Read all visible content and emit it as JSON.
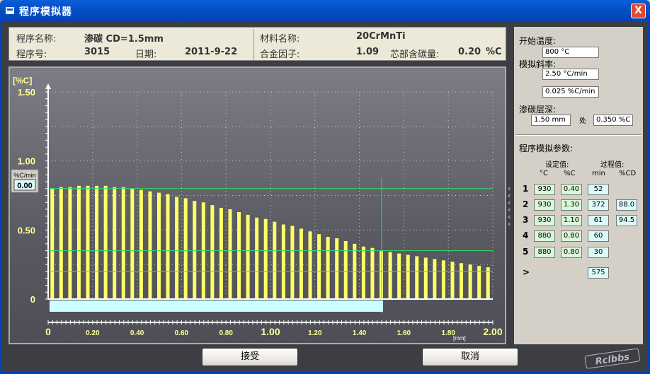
{
  "window": {
    "title": "程序模拟器",
    "close_glyph": "X"
  },
  "info": {
    "program_name_label": "程序名称:",
    "program_name": "渗碳 CD=1.5mm",
    "program_no_label": "程序号:",
    "program_no": "3015",
    "date_label": "日期:",
    "date": "2011-9-22",
    "material_label": "材料名称:",
    "material": "20CrMnTi",
    "alloy_label": "合金因子:",
    "alloy": "1.09",
    "core_label": "芯部含碳量:",
    "core": "0.20",
    "core_unit": "%C"
  },
  "side": {
    "start_temp_label": "开始温度:",
    "start_temp": "800 °C",
    "slope_label": "模拟斜率:",
    "slope1": "2.50 °C/min",
    "slope2": "0.025 %C/min",
    "depth_label": "渗碳层深:",
    "depth": "1.50 mm",
    "at_label": "处",
    "depth_c": "0.350 %C",
    "params_title": "程序模拟参数:",
    "set_header": "设定值:",
    "proc_header": "过程值:",
    "col_c": "°C",
    "col_pc": "%C",
    "col_min": "min",
    "col_pcd": "%CD",
    "rows": [
      {
        "n": "1",
        "temp": "930",
        "pc": "0.40",
        "min": "52",
        "pcd": ""
      },
      {
        "n": "2",
        "temp": "930",
        "pc": "1.30",
        "min": "372",
        "pcd": "88.0"
      },
      {
        "n": "3",
        "temp": "930",
        "pc": "1.10",
        "min": "61",
        "pcd": "94.5"
      },
      {
        "n": "4",
        "temp": "880",
        "pc": "0.80",
        "min": "60",
        "pcd": ""
      },
      {
        "n": "5",
        "temp": "880",
        "pc": "0.80",
        "min": "30",
        "pcd": ""
      }
    ],
    "total_label": ">",
    "total": "575"
  },
  "buttons": {
    "accept": "接受",
    "cancel": "取消"
  },
  "watermark": "Rclbbs",
  "chart_data": {
    "type": "bar",
    "ylabel": "[%C]",
    "xlabel": "[mm]",
    "xlim": [
      0,
      2.0
    ],
    "ylim": [
      0,
      1.5
    ],
    "yticks": [
      "0",
      "0.50",
      "1.00",
      "1.50"
    ],
    "xticks": [
      "0",
      "0.20",
      "0.40",
      "0.60",
      "0.80",
      "1.00",
      "1.20",
      "1.40",
      "1.60",
      "1.80",
      "2.00"
    ],
    "rate_label": "%C/min",
    "rate_value": "0.00",
    "x": [
      0.02,
      0.06,
      0.1,
      0.14,
      0.18,
      0.22,
      0.26,
      0.3,
      0.34,
      0.38,
      0.42,
      0.46,
      0.5,
      0.54,
      0.58,
      0.62,
      0.66,
      0.7,
      0.74,
      0.78,
      0.82,
      0.86,
      0.9,
      0.94,
      0.98,
      1.02,
      1.06,
      1.1,
      1.14,
      1.18,
      1.22,
      1.26,
      1.3,
      1.34,
      1.38,
      1.42,
      1.46,
      1.5,
      1.54,
      1.58,
      1.62,
      1.66,
      1.7,
      1.74,
      1.78,
      1.82,
      1.86,
      1.9,
      1.94,
      1.98
    ],
    "values": [
      0.8,
      0.81,
      0.81,
      0.82,
      0.82,
      0.82,
      0.82,
      0.81,
      0.81,
      0.8,
      0.79,
      0.78,
      0.77,
      0.76,
      0.74,
      0.73,
      0.71,
      0.7,
      0.68,
      0.66,
      0.65,
      0.63,
      0.61,
      0.59,
      0.58,
      0.56,
      0.54,
      0.53,
      0.51,
      0.49,
      0.47,
      0.45,
      0.44,
      0.42,
      0.4,
      0.38,
      0.37,
      0.35,
      0.34,
      0.33,
      0.32,
      0.31,
      0.3,
      0.29,
      0.28,
      0.27,
      0.26,
      0.25,
      0.24,
      0.23
    ],
    "hlines": [
      0.8,
      0.35,
      0.2
    ],
    "vline_x": 1.5,
    "depth_bar_x": [
      0,
      1.5
    ],
    "colors": {
      "bar": "#ffff66",
      "hline": "#33dd66",
      "grid": "#c8c8c8",
      "axis": "#ffffff",
      "tick": "#ffff99",
      "depth": "#ccffff"
    }
  }
}
